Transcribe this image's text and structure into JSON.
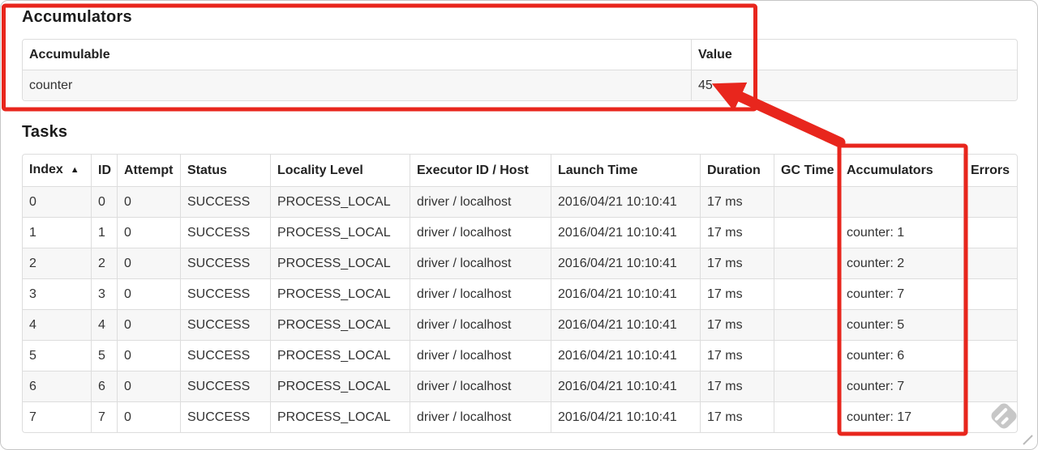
{
  "accumulators": {
    "title": "Accumulators",
    "headers": [
      "Accumulable",
      "Value"
    ],
    "rows": [
      [
        "counter",
        "45"
      ]
    ]
  },
  "tasks": {
    "title": "Tasks",
    "headers": [
      "Index",
      "ID",
      "Attempt",
      "Status",
      "Locality Level",
      "Executor ID / Host",
      "Launch Time",
      "Duration",
      "GC Time",
      "Accumulators",
      "Errors"
    ],
    "sort_indicator": "▲",
    "rows": [
      [
        "0",
        "0",
        "0",
        "SUCCESS",
        "PROCESS_LOCAL",
        "driver / localhost",
        "2016/04/21 10:10:41",
        "17 ms",
        "",
        "",
        ""
      ],
      [
        "1",
        "1",
        "0",
        "SUCCESS",
        "PROCESS_LOCAL",
        "driver / localhost",
        "2016/04/21 10:10:41",
        "17 ms",
        "",
        "counter: 1",
        ""
      ],
      [
        "2",
        "2",
        "0",
        "SUCCESS",
        "PROCESS_LOCAL",
        "driver / localhost",
        "2016/04/21 10:10:41",
        "17 ms",
        "",
        "counter: 2",
        ""
      ],
      [
        "3",
        "3",
        "0",
        "SUCCESS",
        "PROCESS_LOCAL",
        "driver / localhost",
        "2016/04/21 10:10:41",
        "17 ms",
        "",
        "counter: 7",
        ""
      ],
      [
        "4",
        "4",
        "0",
        "SUCCESS",
        "PROCESS_LOCAL",
        "driver / localhost",
        "2016/04/21 10:10:41",
        "17 ms",
        "",
        "counter: 5",
        ""
      ],
      [
        "5",
        "5",
        "0",
        "SUCCESS",
        "PROCESS_LOCAL",
        "driver / localhost",
        "2016/04/21 10:10:41",
        "17 ms",
        "",
        "counter: 6",
        ""
      ],
      [
        "6",
        "6",
        "0",
        "SUCCESS",
        "PROCESS_LOCAL",
        "driver / localhost",
        "2016/04/21 10:10:41",
        "17 ms",
        "",
        "counter: 7",
        ""
      ],
      [
        "7",
        "7",
        "0",
        "SUCCESS",
        "PROCESS_LOCAL",
        "driver / localhost",
        "2016/04/21 10:10:41",
        "17 ms",
        "",
        "counter: 17",
        ""
      ]
    ]
  },
  "annotations": {
    "color": "#e8261d",
    "highlighted_value": "45",
    "highlighted_column": "Accumulators"
  }
}
